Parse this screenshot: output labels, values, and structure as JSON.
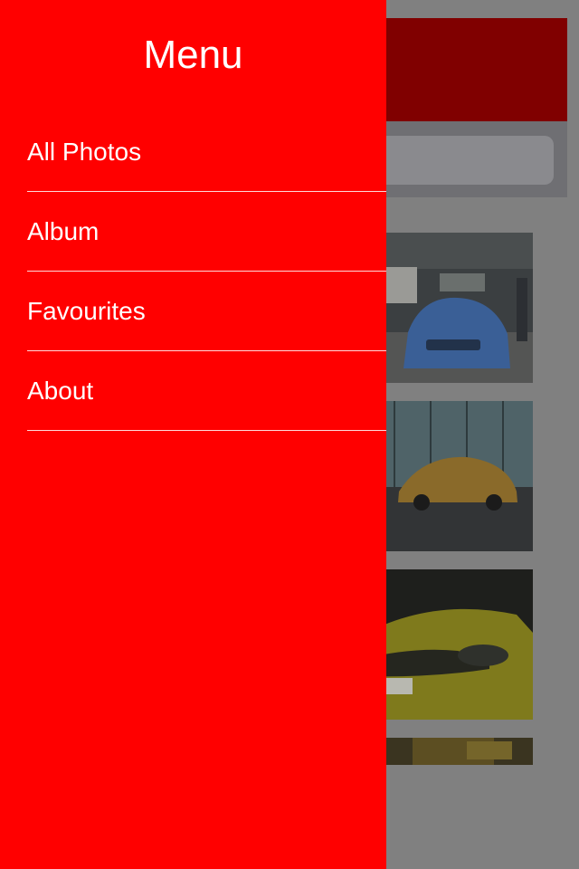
{
  "drawer": {
    "title": "Menu",
    "items": [
      {
        "label": "All Photos"
      },
      {
        "label": "Album"
      },
      {
        "label": "Favourites"
      },
      {
        "label": "About"
      }
    ]
  },
  "colors": {
    "drawer_bg": "#ff0000",
    "header_bg": "#800000",
    "overlay": "#808080",
    "text": "#ffffff"
  },
  "gallery": {
    "photos": [
      {
        "subject": "blue-sports-car-in-parking-lot"
      },
      {
        "subject": "gold-sports-car-in-front-of-glass-building"
      },
      {
        "subject": "yellow-sports-car-front-closeup"
      },
      {
        "subject": "car-on-forest-road"
      }
    ]
  }
}
